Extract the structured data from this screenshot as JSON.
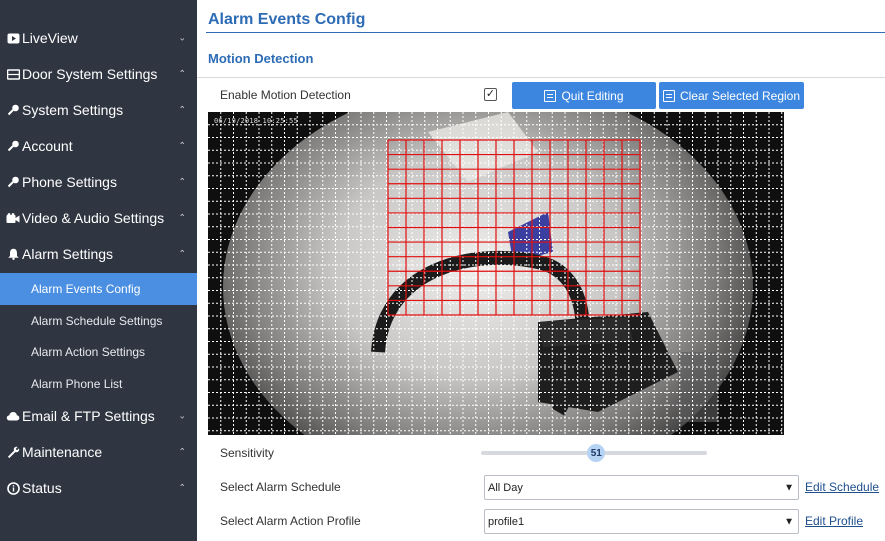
{
  "sidebar": {
    "items": [
      {
        "label": "LiveView",
        "icon": "video-icon",
        "chevron": "⌄"
      },
      {
        "label": "Door System Settings",
        "icon": "door-icon",
        "chevron": "⌃"
      },
      {
        "label": "System Settings",
        "icon": "key-icon",
        "chevron": "⌃"
      },
      {
        "label": "Account",
        "icon": "key-icon",
        "chevron": "⌃"
      },
      {
        "label": "Phone Settings",
        "icon": "key-icon",
        "chevron": "⌃"
      },
      {
        "label": "Video & Audio Settings",
        "icon": "camera-icon",
        "chevron": "⌃"
      },
      {
        "label": "Alarm Settings",
        "icon": "bell-icon",
        "chevron": "⌃"
      },
      {
        "label": "Email & FTP Settings",
        "icon": "cloud-icon",
        "chevron": "⌄"
      },
      {
        "label": "Maintenance",
        "icon": "wrench-icon",
        "chevron": "⌃"
      },
      {
        "label": "Status",
        "icon": "info-icon",
        "chevron": "⌃"
      }
    ],
    "subitems": [
      {
        "label": "Alarm Events Config",
        "active": true
      },
      {
        "label": "Alarm Schedule Settings",
        "active": false
      },
      {
        "label": "Alarm Action Settings",
        "active": false
      },
      {
        "label": "Alarm Phone List",
        "active": false
      }
    ]
  },
  "main": {
    "title": "Alarm Events Config",
    "section": "Motion Detection",
    "enable_label": "Enable Motion Detection",
    "enable_checked": true,
    "checkmark": "✓",
    "quit_button": "Quit Editing",
    "clear_button": "Clear Selected Region",
    "timestamp": "06/19/2018 10:25:55",
    "sensitivity_label": "Sensitivity",
    "sensitivity_value": "51",
    "schedule_label": "Select Alarm Schedule",
    "schedule_value": "All Day",
    "schedule_link": "Edit Schedule",
    "profile_label": "Select Alarm Action Profile",
    "profile_value": "profile1",
    "profile_link": "Edit Profile",
    "select_arrow": "▼"
  },
  "colors": {
    "sidebar_bg": "#2f3541",
    "active_item": "#4a8fe2",
    "accent": "#2d6cb5",
    "button": "#3d86e0",
    "region_outline": "#e01010"
  }
}
